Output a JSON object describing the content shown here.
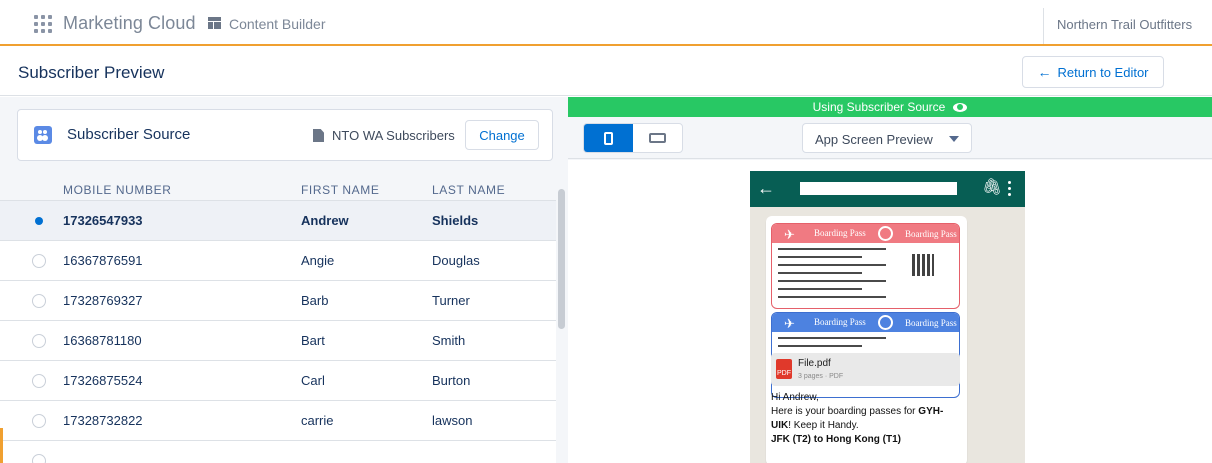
{
  "header": {
    "app_name": "Marketing Cloud",
    "module_name": "Content Builder",
    "org_name": "Northern Trail Outfitters"
  },
  "page": {
    "title": "Subscriber Preview",
    "return_label": "Return to Editor"
  },
  "subscriber_source": {
    "title": "Subscriber Source",
    "file": "NTO WA Subscribers",
    "change_label": "Change"
  },
  "table": {
    "columns": [
      "MOBILE NUMBER",
      "FIRST NAME",
      "LAST NAME"
    ],
    "rows": [
      {
        "mobile": "17326547933",
        "first": "Andrew",
        "last": "Shields",
        "selected": true
      },
      {
        "mobile": "16367876591",
        "first": "Angie",
        "last": "Douglas",
        "selected": false
      },
      {
        "mobile": "17328769327",
        "first": "Barb",
        "last": "Turner",
        "selected": false
      },
      {
        "mobile": "16368781180",
        "first": "Bart",
        "last": "Smith",
        "selected": false
      },
      {
        "mobile": "17326875524",
        "first": "Carl",
        "last": "Burton",
        "selected": false
      },
      {
        "mobile": "17328732822",
        "first": "carrie",
        "last": "lawson",
        "selected": false
      }
    ]
  },
  "preview": {
    "source_banner": "Using Subscriber Source",
    "mode_select": "App Screen Preview",
    "pass_title": "Boarding Pass",
    "file_name": "File.pdf",
    "file_meta": "3 pages · PDF",
    "pdf_label": "PDF",
    "message": {
      "greeting": "Hi Andrew,",
      "line1_pre": "Here is your boarding passes for ",
      "line1_bold": "GYH-",
      "line2_bold": "UIK",
      "line2_post": "! Keep it Handy.",
      "line3": "JFK (T2) to Hong Kong (T1)"
    }
  },
  "colors": {
    "accent": "#0070d2",
    "header_rule": "#f0a030",
    "source_banner": "#28c864",
    "whatsapp_header": "#075e54"
  }
}
